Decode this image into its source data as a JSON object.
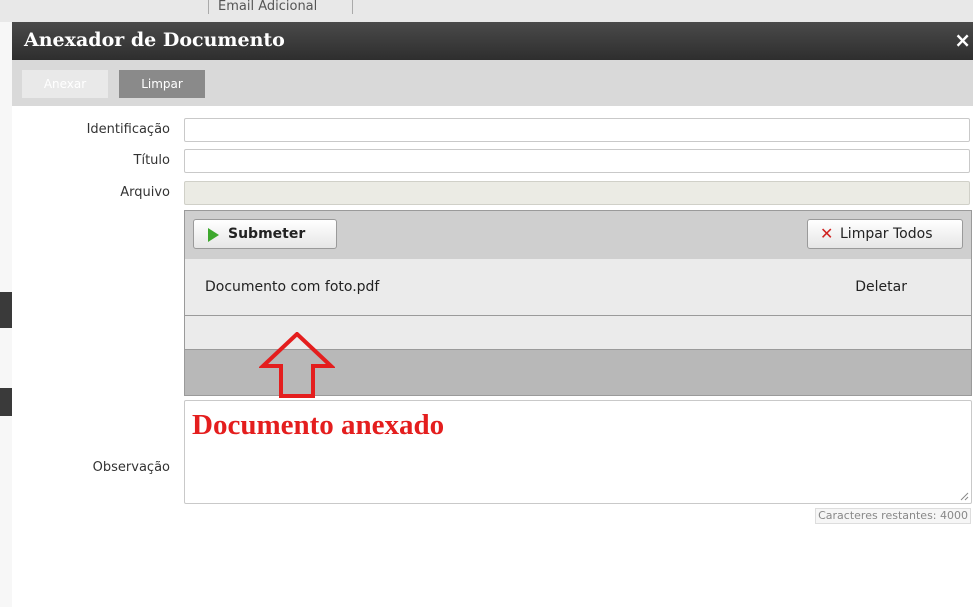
{
  "background": {
    "top_text": "Email Adicional"
  },
  "dialog": {
    "title": "Anexador de Documento",
    "close_glyph": "×"
  },
  "toolbar": {
    "anexar_label": "Anexar",
    "limpar_label": "Limpar"
  },
  "form": {
    "identificacao_label": "Identificação",
    "identificacao_value": "",
    "titulo_label": "Título",
    "titulo_value": "",
    "arquivo_label": "Arquivo",
    "observacao_label": "Observação"
  },
  "uploader": {
    "submit_label": "Submeter",
    "clear_all_label": "Limpar Todos",
    "files": [
      {
        "name": "Documento com foto.pdf",
        "action": "Deletar"
      }
    ]
  },
  "annotation": {
    "text": "Documento anexado",
    "color": "#e41e1e"
  },
  "counter": {
    "text": "Caracteres restantes: 4000"
  }
}
